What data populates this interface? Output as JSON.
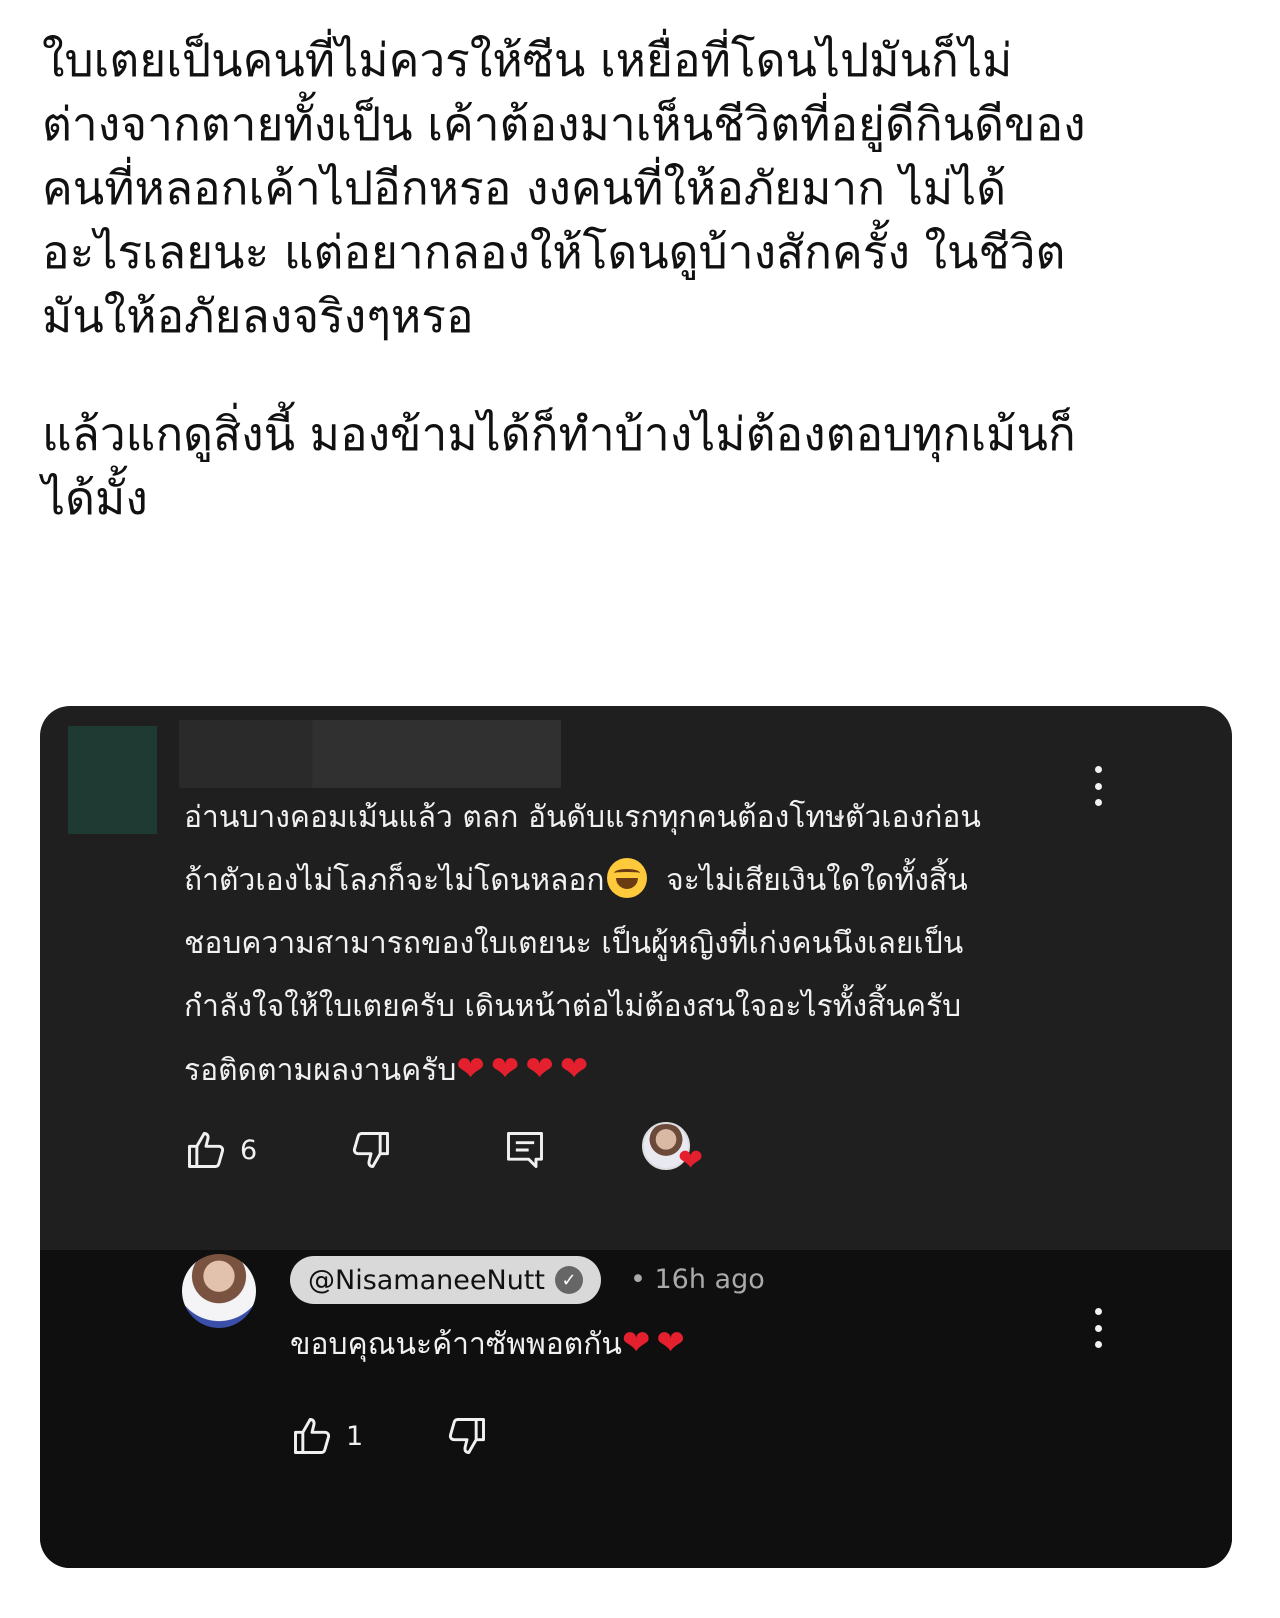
{
  "post": {
    "paragraph1": "ใบเตยเป็นคนที่ไม่ควรให้ซีน เหยื่อที่โดนไปมันก็ไม่\nต่างจากตายทั้งเป็น เค้าต้องมาเห็นชีวิตที่อยู่ดีกินดีของ\nคนที่หลอกเค้าไปอีกหรอ งงคนที่ให้อภัยมาก ไม่ได้\nอะไรเลยนะ แต่อยากลองให้โดนดูบ้างสักครั้ง ในชีวิต\nมันให้อภัยลงจริงๆหรอ",
    "paragraph2": "แล้วแกดูสิ่งนี้ มองข้ามได้ก็ทำบ้างไม่ต้องตอบทุกเม้นก็\nได้มั้ง"
  },
  "comment": {
    "line1": "อ่านบางคอมเม้นแล้ว ตลก อันดับแรกทุกคนต้องโทษตัวเองก่อน",
    "line2a": "ถ้าตัวเองไม่โลภก็จะไม่โดนหลอก",
    "line2b": "จะไม่เสียเงินใดใดทั้งสิ้น",
    "line3": "ชอบความสามารถของใบเตยนะ เป็นผู้หญิงที่เก่งคนนึงเลยเป็น",
    "line4": "กำลังใจให้ใบเตยครับ  เดินหน้าต่อไม่ต้องสนใจอะไรทั้งสิ้นครับ",
    "line5": "รอติดตามผลงานครับ",
    "hearts": "❤❤❤❤",
    "like_count": "6"
  },
  "reply": {
    "handle": "@NisamaneeNutt",
    "time": "• 16h ago",
    "text": "ขอบคุณนะค้าาซัพพอตกัน",
    "hearts": "❤❤",
    "like_count": "1"
  },
  "colors": {
    "card_bg": "#1f1f1f",
    "reply_bg": "#0f0f0f",
    "heart": "#e5202e",
    "text_light": "#f1f1f1",
    "meta": "#aaaaaa"
  },
  "icons": [
    "like-icon",
    "dislike-icon",
    "reply-icon",
    "more-vert-icon",
    "verified-icon",
    "heart-icon",
    "laughing-emoji-icon"
  ]
}
